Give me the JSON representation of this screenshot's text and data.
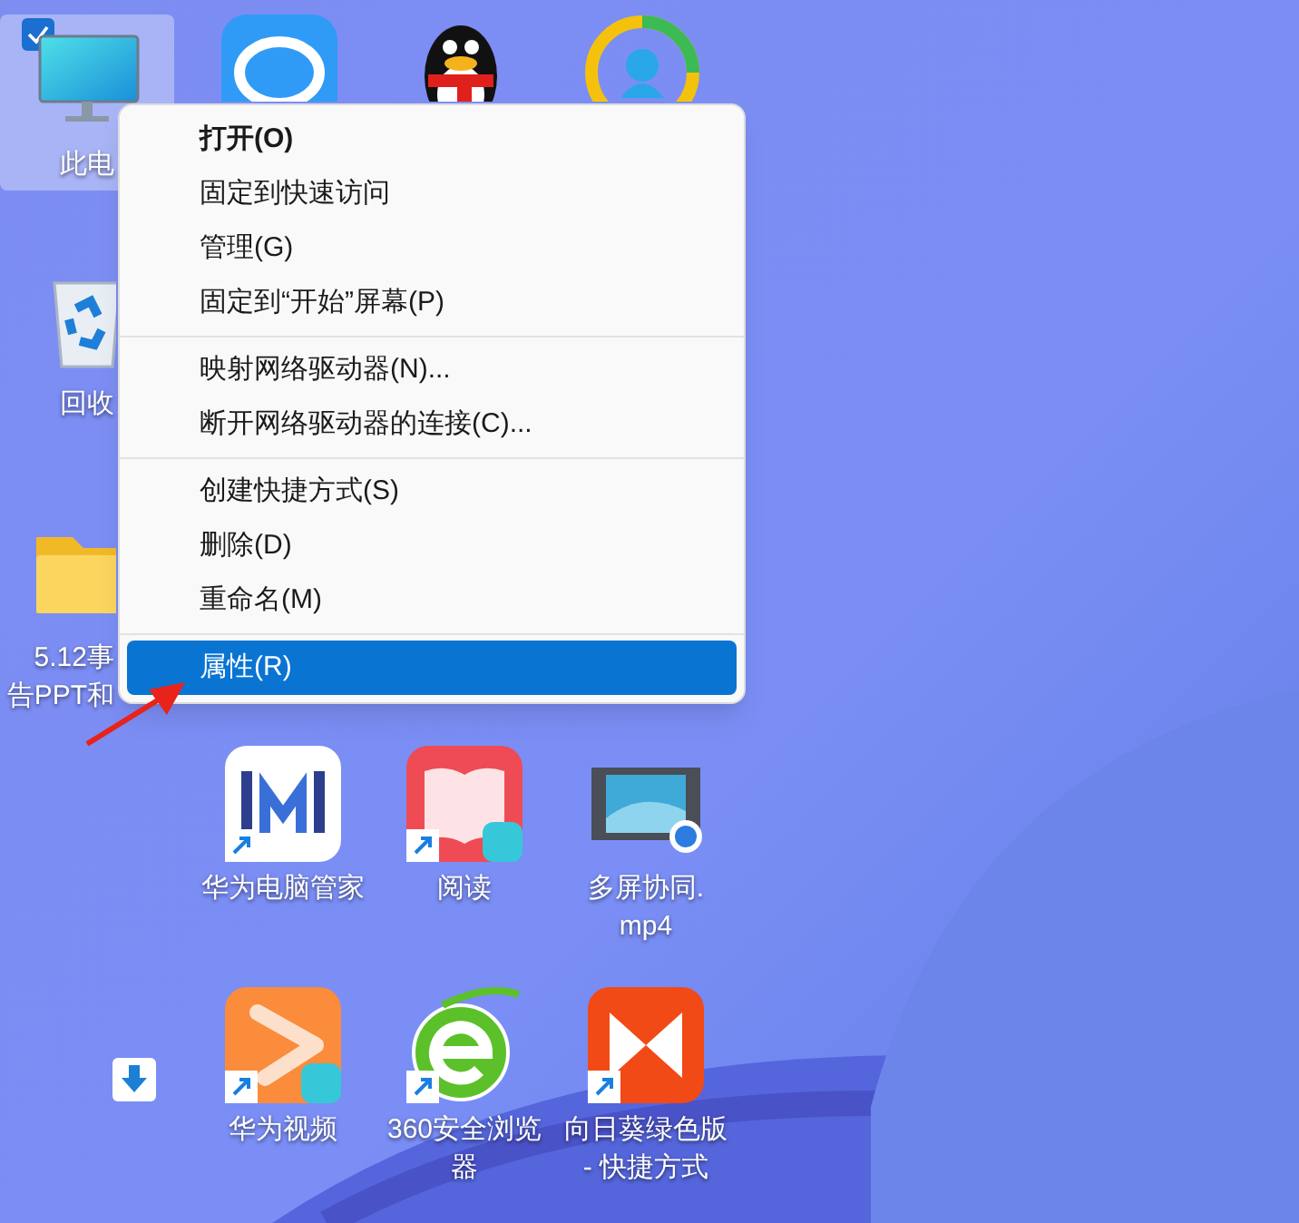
{
  "desktop_icons": [
    {
      "kind": "monitor",
      "label": [
        "此电"
      ],
      "selected": true,
      "shortcut": false
    },
    {
      "kind": "chat",
      "selected": false,
      "shortcut": false
    },
    {
      "kind": "penguin",
      "selected": false,
      "shortcut": false
    },
    {
      "kind": "ring",
      "selected": false,
      "shortcut": false
    },
    {
      "kind": "recycle",
      "label": [
        "回收"
      ],
      "selected": false,
      "shortcut": false
    },
    {
      "kind": "folder",
      "label": [
        "5.12事",
        "告PPT和"
      ],
      "selected": false,
      "shortcut": false
    },
    {
      "kind": "mlogo",
      "label": [
        "华为电脑管家"
      ],
      "selected": false,
      "shortcut": true
    },
    {
      "kind": "book",
      "label": [
        "阅读"
      ],
      "selected": false,
      "shortcut": true
    },
    {
      "kind": "video",
      "label": [
        "多屏协同.",
        "mp4"
      ],
      "selected": false,
      "shortcut": false
    },
    {
      "kind": "download",
      "selected": false,
      "shortcut": false
    },
    {
      "kind": "play",
      "label": [
        "华为视频"
      ],
      "selected": false,
      "shortcut": true
    },
    {
      "kind": "browser",
      "label": [
        "360安全浏览",
        "器"
      ],
      "selected": false,
      "shortcut": true
    },
    {
      "kind": "sunflower",
      "label": [
        "向日葵绿色版",
        "- 快捷方式"
      ],
      "selected": false,
      "shortcut": true
    }
  ],
  "context_menu": {
    "groups": [
      [
        {
          "label": "打开(O)",
          "bold": true,
          "selected": false
        },
        {
          "label": "固定到快速访问",
          "bold": false,
          "selected": false
        },
        {
          "label": "管理(G)",
          "bold": false,
          "selected": false
        },
        {
          "label": "固定到“开始”屏幕(P)",
          "bold": false,
          "selected": false
        }
      ],
      [
        {
          "label": "映射网络驱动器(N)...",
          "bold": false,
          "selected": false
        },
        {
          "label": "断开网络驱动器的连接(C)...",
          "bold": false,
          "selected": false
        }
      ],
      [
        {
          "label": "创建快捷方式(S)",
          "bold": false,
          "selected": false
        },
        {
          "label": "删除(D)",
          "bold": false,
          "selected": false
        },
        {
          "label": "重命名(M)",
          "bold": false,
          "selected": false
        }
      ],
      [
        {
          "label": "属性(R)",
          "bold": false,
          "selected": true
        }
      ]
    ]
  }
}
